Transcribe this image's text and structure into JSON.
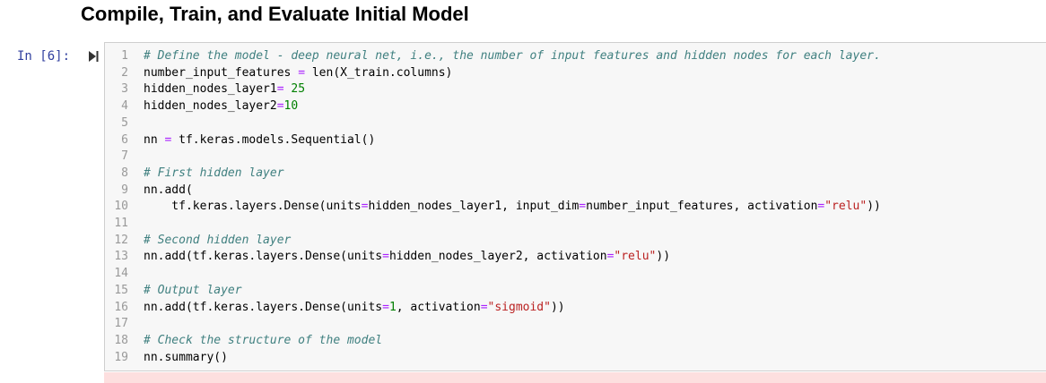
{
  "heading": "Compile, Train, and Evaluate Initial Model",
  "prompt": "In [6]:",
  "icons": {
    "run": "step-forward-icon"
  },
  "colors": {
    "comment": "#408080",
    "operator": "#aa22ff",
    "number": "#008000",
    "string": "#ba2121",
    "prompt": "#303f9f",
    "cell_bg": "#f7f7f7",
    "output_bg": "#fddfdf"
  },
  "code_lines": [
    {
      "num": "1",
      "tokens": [
        {
          "t": "c",
          "s": "# Define the model - deep neural net, i.e., the number of input features and hidden nodes for each layer."
        }
      ]
    },
    {
      "num": "2",
      "tokens": [
        {
          "t": "p",
          "s": "number_input_features "
        },
        {
          "t": "o",
          "s": "="
        },
        {
          "t": "p",
          "s": " len(X_train.columns)"
        }
      ]
    },
    {
      "num": "3",
      "tokens": [
        {
          "t": "p",
          "s": "hidden_nodes_layer1"
        },
        {
          "t": "o",
          "s": "="
        },
        {
          "t": "p",
          "s": " "
        },
        {
          "t": "n",
          "s": "25"
        }
      ]
    },
    {
      "num": "4",
      "tokens": [
        {
          "t": "p",
          "s": "hidden_nodes_layer2"
        },
        {
          "t": "o",
          "s": "="
        },
        {
          "t": "n",
          "s": "10"
        }
      ]
    },
    {
      "num": "5",
      "tokens": []
    },
    {
      "num": "6",
      "tokens": [
        {
          "t": "p",
          "s": "nn "
        },
        {
          "t": "o",
          "s": "="
        },
        {
          "t": "p",
          "s": " tf.keras.models.Sequential()"
        }
      ]
    },
    {
      "num": "7",
      "tokens": []
    },
    {
      "num": "8",
      "tokens": [
        {
          "t": "c",
          "s": "# First hidden layer"
        }
      ]
    },
    {
      "num": "9",
      "tokens": [
        {
          "t": "p",
          "s": "nn.add("
        }
      ]
    },
    {
      "num": "10",
      "tokens": [
        {
          "t": "p",
          "s": "    tf.keras.layers.Dense(units"
        },
        {
          "t": "o",
          "s": "="
        },
        {
          "t": "p",
          "s": "hidden_nodes_layer1, input_dim"
        },
        {
          "t": "o",
          "s": "="
        },
        {
          "t": "p",
          "s": "number_input_features, activation"
        },
        {
          "t": "o",
          "s": "="
        },
        {
          "t": "s",
          "s": "\"relu\""
        },
        {
          "t": "p",
          "s": "))"
        }
      ]
    },
    {
      "num": "11",
      "tokens": []
    },
    {
      "num": "12",
      "tokens": [
        {
          "t": "c",
          "s": "# Second hidden layer"
        }
      ]
    },
    {
      "num": "13",
      "tokens": [
        {
          "t": "p",
          "s": "nn.add(tf.keras.layers.Dense(units"
        },
        {
          "t": "o",
          "s": "="
        },
        {
          "t": "p",
          "s": "hidden_nodes_layer2, activation"
        },
        {
          "t": "o",
          "s": "="
        },
        {
          "t": "s",
          "s": "\"relu\""
        },
        {
          "t": "p",
          "s": "))"
        }
      ]
    },
    {
      "num": "14",
      "tokens": []
    },
    {
      "num": "15",
      "tokens": [
        {
          "t": "c",
          "s": "# Output layer"
        }
      ]
    },
    {
      "num": "16",
      "tokens": [
        {
          "t": "p",
          "s": "nn.add(tf.keras.layers.Dense(units"
        },
        {
          "t": "o",
          "s": "="
        },
        {
          "t": "n",
          "s": "1"
        },
        {
          "t": "p",
          "s": ", activation"
        },
        {
          "t": "o",
          "s": "="
        },
        {
          "t": "s",
          "s": "\"sigmoid\""
        },
        {
          "t": "p",
          "s": "))"
        }
      ]
    },
    {
      "num": "17",
      "tokens": []
    },
    {
      "num": "18",
      "tokens": [
        {
          "t": "c",
          "s": "# Check the structure of the model"
        }
      ]
    },
    {
      "num": "19",
      "tokens": [
        {
          "t": "p",
          "s": "nn.summary()"
        }
      ]
    }
  ]
}
